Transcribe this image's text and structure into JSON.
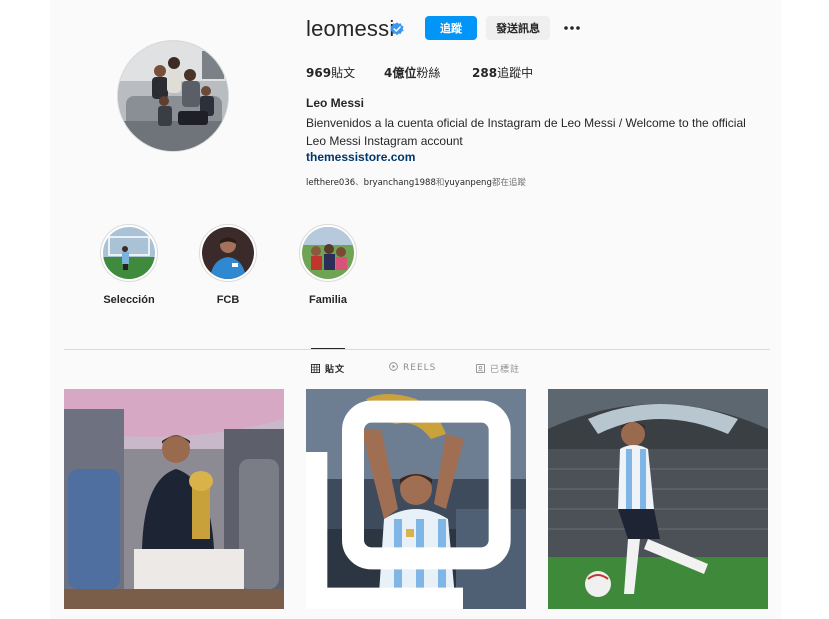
{
  "profile": {
    "username": "leomessi",
    "follow_label": "追蹤",
    "message_label": "發送訊息",
    "stats": {
      "posts": {
        "count": "969",
        "label": "貼文"
      },
      "followers": {
        "count": "4億位",
        "label": "粉絲"
      },
      "following": {
        "count": "288",
        "label": "追蹤中"
      }
    },
    "full_name": "Leo Messi",
    "bio": "Bienvenidos a la cuenta oficial de Instagram de Leo Messi / Welcome to the official Leo Messi Instagram account",
    "link": "themessistore.com",
    "followed_by": {
      "user1": "lefthere036",
      "sep1": "、",
      "user2": "bryanchang1988",
      "sep2": "和",
      "user3": "yuyanpeng",
      "suffix": "都在追蹤"
    }
  },
  "highlights": [
    {
      "label": "Selección"
    },
    {
      "label": "FCB"
    },
    {
      "label": "Familia"
    }
  ],
  "tabs": {
    "posts": "貼文",
    "reels": "REELS",
    "tagged": "已標註"
  },
  "colors": {
    "accent": "#0095f6",
    "link": "#00376b",
    "verified": "#3897f0"
  }
}
